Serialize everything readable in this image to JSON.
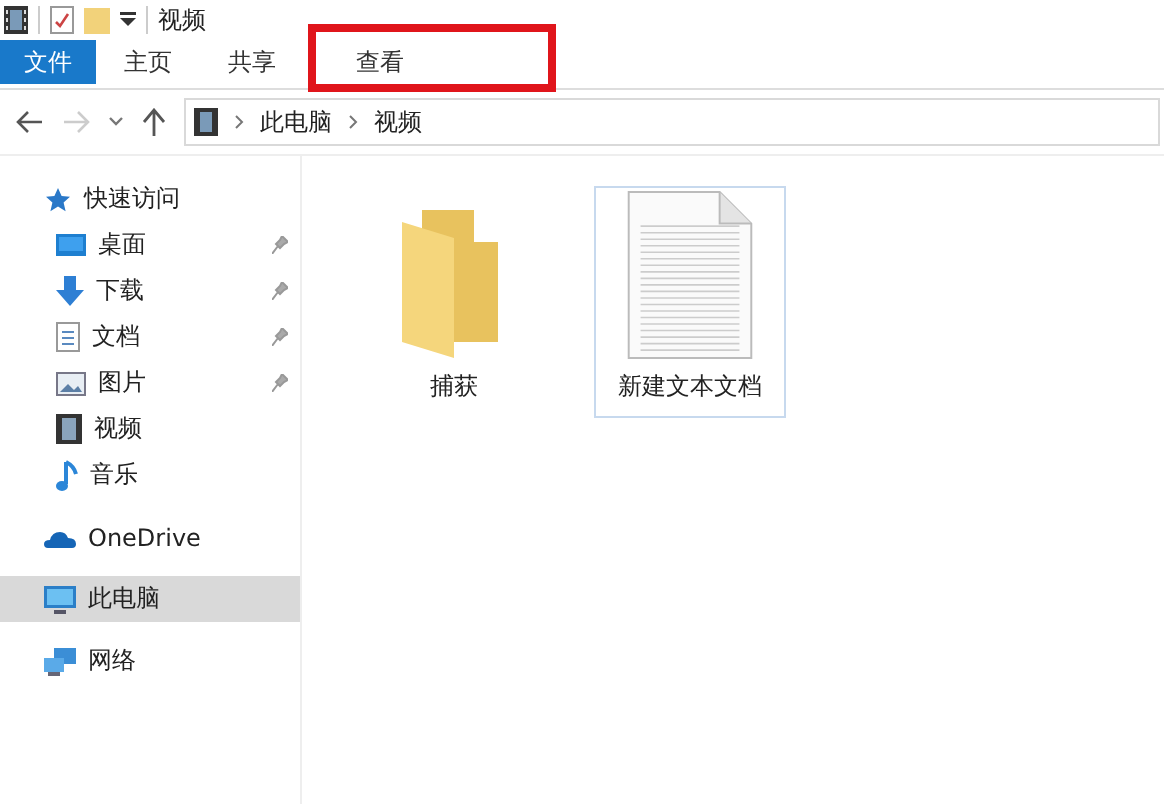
{
  "window": {
    "title": "视频"
  },
  "ribbon_tabs": [
    {
      "label": "文件",
      "kind": "file",
      "highlighted": false
    },
    {
      "label": "主页",
      "kind": "tab",
      "highlighted": false
    },
    {
      "label": "共享",
      "kind": "tab",
      "highlighted": false
    },
    {
      "label": "查看",
      "kind": "tab",
      "highlighted": true
    }
  ],
  "address_bar": {
    "crumbs": [
      "此电脑",
      "视频"
    ]
  },
  "sidebar": {
    "items": [
      {
        "label": "快速访问",
        "pinned": false,
        "selected": false
      },
      {
        "label": "桌面",
        "pinned": true,
        "selected": false
      },
      {
        "label": "下载",
        "pinned": true,
        "selected": false
      },
      {
        "label": "文档",
        "pinned": true,
        "selected": false
      },
      {
        "label": "图片",
        "pinned": true,
        "selected": false
      },
      {
        "label": "视频",
        "pinned": false,
        "selected": false
      },
      {
        "label": "音乐",
        "pinned": false,
        "selected": false
      },
      {
        "label": "OneDrive",
        "pinned": false,
        "selected": false
      },
      {
        "label": "此电脑",
        "pinned": false,
        "selected": true
      },
      {
        "label": "网络",
        "pinned": false,
        "selected": false
      }
    ]
  },
  "files": [
    {
      "name": "捕获",
      "kind": "folder",
      "selected": false
    },
    {
      "name": "新建文本文档",
      "kind": "text",
      "selected": true
    }
  ]
}
